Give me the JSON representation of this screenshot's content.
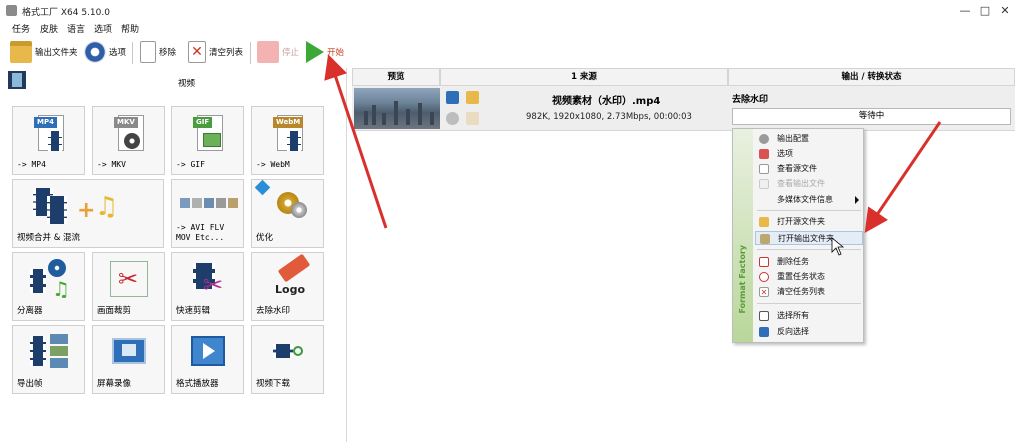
{
  "window": {
    "title": "格式工厂 X64 5.10.0",
    "controls": [
      "—",
      "□",
      "✕"
    ]
  },
  "menu": [
    "任务",
    "皮肤",
    "语言",
    "选项",
    "帮助"
  ],
  "toolbar": {
    "output_folder": "输出文件夹",
    "options": "选项",
    "remove": "移除",
    "clear_list": "清空列表",
    "stop": "停止",
    "start": "开始"
  },
  "left": {
    "section": "视频",
    "tiles": [
      {
        "caption": "-> MP4",
        "badge": "MP4"
      },
      {
        "caption": "-> MKV",
        "badge": "MKV"
      },
      {
        "caption": "-> GIF",
        "badge": "GIF"
      },
      {
        "caption": "-> WebM",
        "badge": "WebM"
      },
      {
        "caption": "视频合并 & 混流"
      },
      {
        "caption": "-> AVI FLV\nMOV Etc..."
      },
      {
        "caption": "优化"
      },
      {
        "caption": "分离器"
      },
      {
        "caption": "画面裁剪"
      },
      {
        "caption": "快速剪辑"
      },
      {
        "caption": "去除水印",
        "art_text": "Logo"
      },
      {
        "caption": "导出帧"
      },
      {
        "caption": "屏幕录像"
      },
      {
        "caption": "格式播放器"
      },
      {
        "caption": "视频下载"
      }
    ]
  },
  "table": {
    "headers": [
      "预览",
      "1 来源",
      "输出 / 转换状态"
    ],
    "rows": [
      {
        "filename": "视频素材（水印）.mp4",
        "info": "982K, 1920x1080, 2.73Mbps, 00:00:03",
        "status_title": "去除水印",
        "status": "等待中"
      }
    ]
  },
  "context_menu": {
    "brand": "Format Factory",
    "items": [
      {
        "label": "输出配置",
        "disabled": false
      },
      {
        "label": "选项",
        "disabled": false
      },
      {
        "label": "查看源文件",
        "disabled": false
      },
      {
        "label": "查看输出文件",
        "disabled": true
      },
      {
        "label": "多媒体文件信息",
        "disabled": false,
        "submenu": true
      },
      {
        "label": "打开源文件夹",
        "disabled": false
      },
      {
        "label": "打开输出文件夹",
        "disabled": false,
        "hover": true
      },
      {
        "label": "删除任务",
        "disabled": false
      },
      {
        "label": "重置任务状态",
        "disabled": false
      },
      {
        "label": "清空任务列表",
        "disabled": false
      },
      {
        "label": "选择所有",
        "disabled": false
      },
      {
        "label": "反向选择",
        "disabled": false
      }
    ]
  },
  "colors": {
    "annotation_arrow": "#d9302c",
    "start_green": "#3aa935",
    "tile_border": "#d0d0d0"
  }
}
